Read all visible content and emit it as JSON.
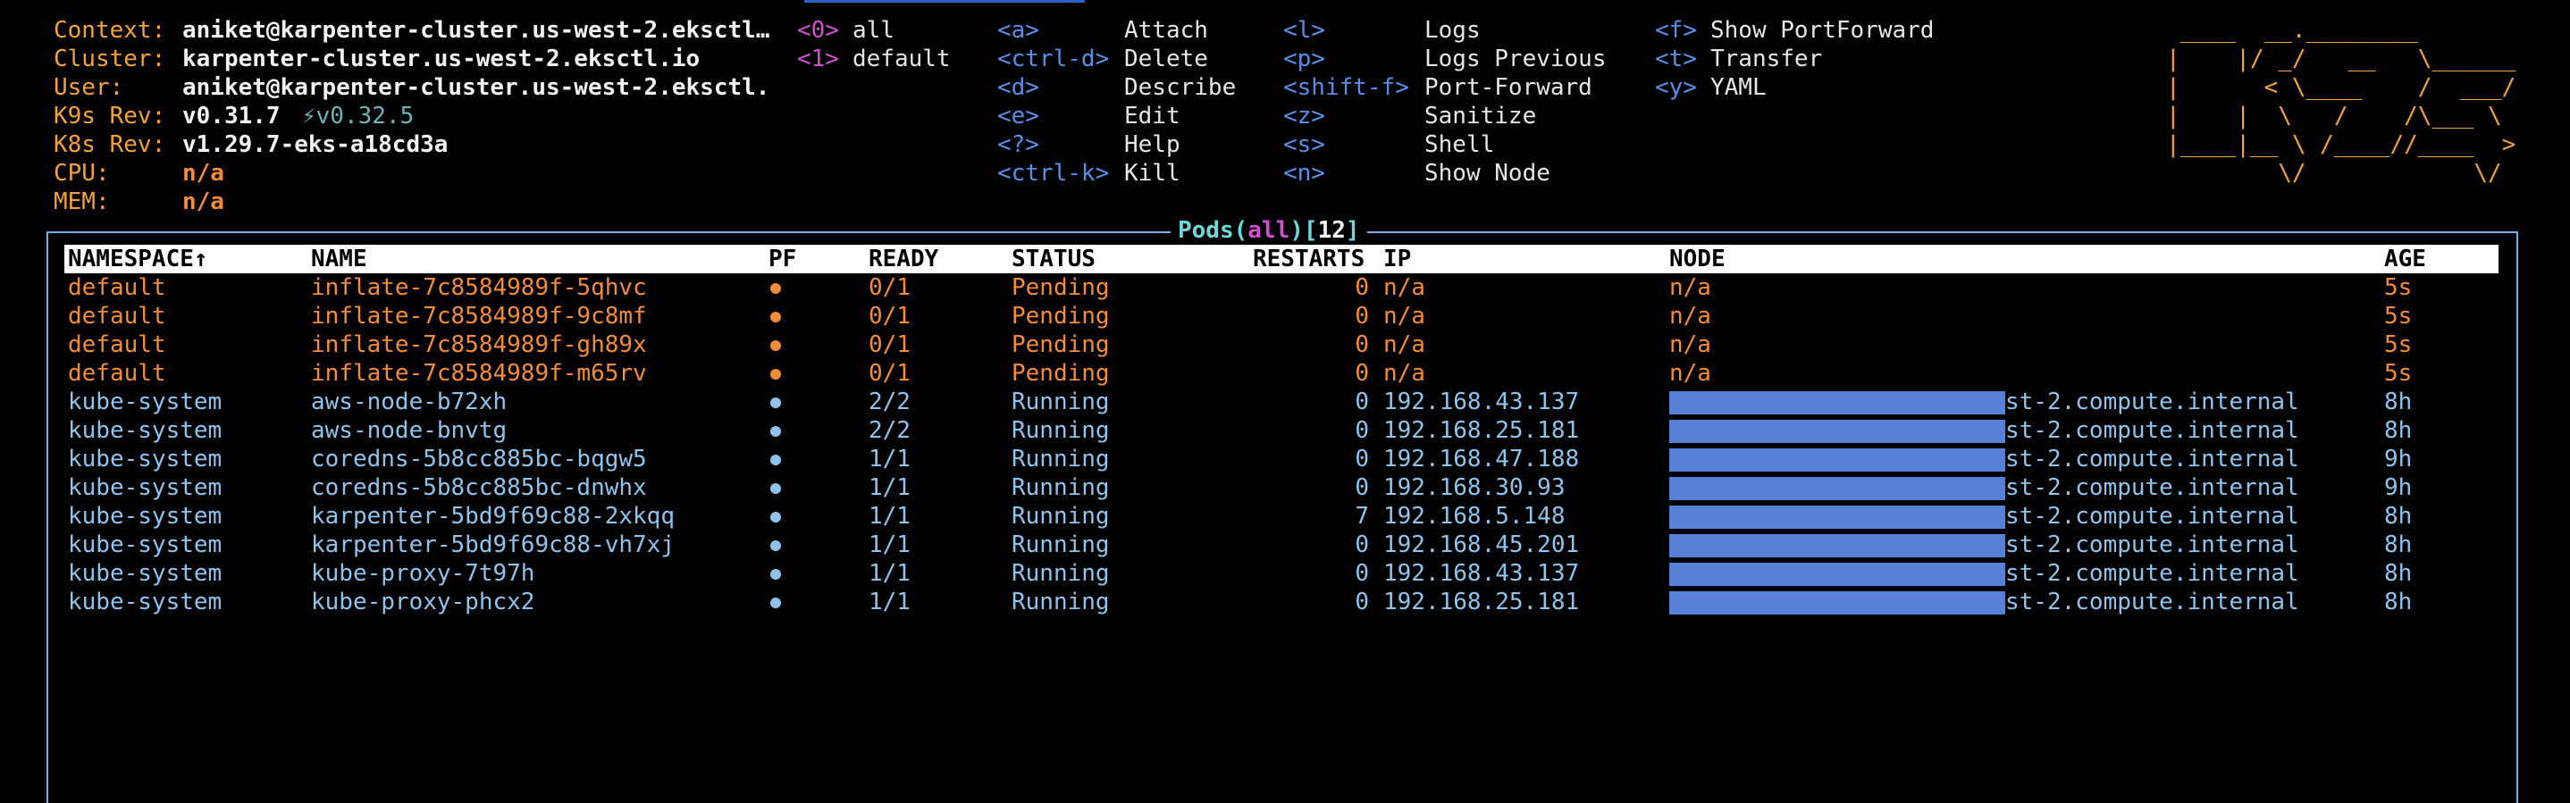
{
  "info": [
    {
      "label": "Context:",
      "value": "aniket@karpenter-cluster.us-west-2.eksctl…"
    },
    {
      "label": "Cluster:",
      "value": "karpenter-cluster.us-west-2.eksctl.io"
    },
    {
      "label": "User:",
      "value": "aniket@karpenter-cluster.us-west-2.eksctl."
    },
    {
      "label": "K9s Rev:",
      "value": "v0.31.7",
      "new_version": "⚡v0.32.5"
    },
    {
      "label": "K8s Rev:",
      "value": "v1.29.7-eks-a18cd3a"
    },
    {
      "label": "CPU:",
      "value": "n/a"
    },
    {
      "label": "MEM:",
      "value": "n/a"
    }
  ],
  "namespaces": [
    {
      "key": "<0>",
      "name": "all"
    },
    {
      "key": "<1>",
      "name": "default"
    }
  ],
  "shortcuts_col1": [
    {
      "key": "<a>",
      "action": "Attach"
    },
    {
      "key": "<ctrl-d>",
      "action": "Delete"
    },
    {
      "key": "<d>",
      "action": "Describe"
    },
    {
      "key": "<e>",
      "action": "Edit"
    },
    {
      "key": "<?>",
      "action": "Help"
    },
    {
      "key": "<ctrl-k>",
      "action": "Kill"
    }
  ],
  "shortcuts_col2": [
    {
      "key": "<l>",
      "action": "Logs"
    },
    {
      "key": "<p>",
      "action": "Logs Previous"
    },
    {
      "key": "<shift-f>",
      "action": "Port-Forward"
    },
    {
      "key": "<z>",
      "action": "Sanitize"
    },
    {
      "key": "<s>",
      "action": "Shell"
    },
    {
      "key": "<n>",
      "action": "Show Node"
    }
  ],
  "shortcuts_col3": [
    {
      "key": "<f>",
      "action": "Show PortForward"
    },
    {
      "key": "<t>",
      "action": "Transfer"
    },
    {
      "key": "<y>",
      "action": "YAML"
    }
  ],
  "logo_ascii": " ____  __.________       \n|    |/ _/   __   \\______\n|      < \\____    /  ___/\n|    |  \\   /    /\\___ \\ \n|____|__ \\ /____//____  >\n        \\/            \\/ ",
  "view": {
    "resource": "Pods",
    "open_paren": "(",
    "filter": "all",
    "close_paren": ")",
    "open_br": "[",
    "count": "12",
    "close_br": "]"
  },
  "columns": {
    "namespace": "NAMESPACE↑",
    "name": "NAME",
    "pf": "PF",
    "ready": "READY",
    "status": "STATUS",
    "restarts": "RESTARTS",
    "ip": "IP",
    "node": "NODE",
    "age": "AGE"
  },
  "pods": [
    {
      "namespace": "default",
      "name": "inflate-7c8584989f-5qhvc",
      "ready": "0/1",
      "status": "Pending",
      "restarts": "0",
      "ip": "n/a",
      "node": "n/a",
      "age": "5s",
      "state": "pending"
    },
    {
      "namespace": "default",
      "name": "inflate-7c8584989f-9c8mf",
      "ready": "0/1",
      "status": "Pending",
      "restarts": "0",
      "ip": "n/a",
      "node": "n/a",
      "age": "5s",
      "state": "pending"
    },
    {
      "namespace": "default",
      "name": "inflate-7c8584989f-gh89x",
      "ready": "0/1",
      "status": "Pending",
      "restarts": "0",
      "ip": "n/a",
      "node": "n/a",
      "age": "5s",
      "state": "pending"
    },
    {
      "namespace": "default",
      "name": "inflate-7c8584989f-m65rv",
      "ready": "0/1",
      "status": "Pending",
      "restarts": "0",
      "ip": "n/a",
      "node": "n/a",
      "age": "5s",
      "state": "pending"
    },
    {
      "namespace": "kube-system",
      "name": "aws-node-b72xh",
      "ready": "2/2",
      "status": "Running",
      "restarts": "0",
      "ip": "192.168.43.137",
      "node": "st-2.compute.internal",
      "age": "8h",
      "state": "running"
    },
    {
      "namespace": "kube-system",
      "name": "aws-node-bnvtg",
      "ready": "2/2",
      "status": "Running",
      "restarts": "0",
      "ip": "192.168.25.181",
      "node": "st-2.compute.internal",
      "age": "8h",
      "state": "running"
    },
    {
      "namespace": "kube-system",
      "name": "coredns-5b8cc885bc-bqgw5",
      "ready": "1/1",
      "status": "Running",
      "restarts": "0",
      "ip": "192.168.47.188",
      "node": "st-2.compute.internal",
      "age": "9h",
      "state": "running"
    },
    {
      "namespace": "kube-system",
      "name": "coredns-5b8cc885bc-dnwhx",
      "ready": "1/1",
      "status": "Running",
      "restarts": "0",
      "ip": "192.168.30.93",
      "node": "st-2.compute.internal",
      "age": "9h",
      "state": "running"
    },
    {
      "namespace": "kube-system",
      "name": "karpenter-5bd9f69c88-2xkqq",
      "ready": "1/1",
      "status": "Running",
      "restarts": "7",
      "ip": "192.168.5.148",
      "node": "st-2.compute.internal",
      "age": "8h",
      "state": "running"
    },
    {
      "namespace": "kube-system",
      "name": "karpenter-5bd9f69c88-vh7xj",
      "ready": "1/1",
      "status": "Running",
      "restarts": "0",
      "ip": "192.168.45.201",
      "node": "st-2.compute.internal",
      "age": "8h",
      "state": "running"
    },
    {
      "namespace": "kube-system",
      "name": "kube-proxy-7t97h",
      "ready": "1/1",
      "status": "Running",
      "restarts": "0",
      "ip": "192.168.43.137",
      "node": "st-2.compute.internal",
      "age": "8h",
      "state": "running"
    },
    {
      "namespace": "kube-system",
      "name": "kube-proxy-phcx2",
      "ready": "1/1",
      "status": "Running",
      "restarts": "0",
      "ip": "192.168.25.181",
      "node": "st-2.compute.internal",
      "age": "8h",
      "state": "running"
    }
  ],
  "colors": {
    "label": "#f2a23a",
    "pending": "#f28c3a",
    "running": "#8fc3ec",
    "namespace_key": "#d44fd0",
    "shortcut_key": "#5a8ee6",
    "frame": "#7aaee0"
  }
}
